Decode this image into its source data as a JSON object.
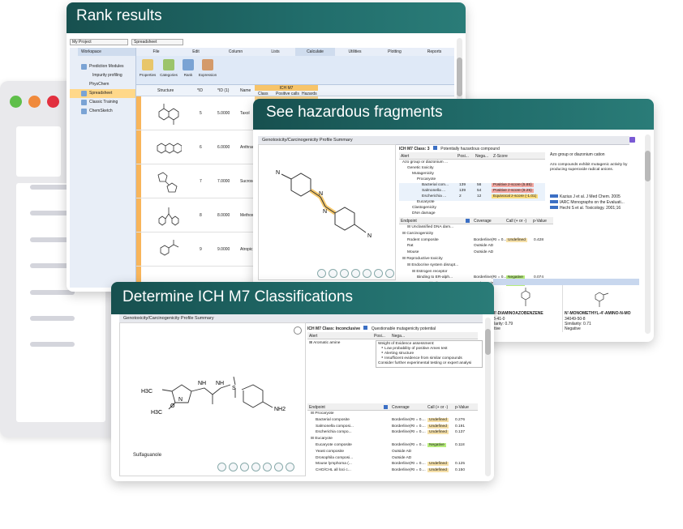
{
  "rank": {
    "title": "Rank results",
    "project": "My Project",
    "view": "Spreadsheet",
    "menu": [
      "File",
      "Edit",
      "Column",
      "Lists",
      "Calculate",
      "Utilities",
      "Plotting",
      "Reports"
    ],
    "ribbon": [
      "Properties",
      "Categories",
      "Rank",
      "Expression"
    ],
    "nav": {
      "workspace": "Workspace",
      "side_label": "Uses sources",
      "items": [
        "Prediction Modules",
        "Impurity profiling",
        "PhysChem",
        "Spreadsheet",
        "Classic Training",
        "ChemSketch"
      ]
    },
    "columns": {
      "structure": "Structure",
      "id": "*ID",
      "id1": "*ID (1)",
      "name": "Name",
      "group": "ICH M7",
      "class": "Class",
      "positive": "Positive calls",
      "hazards": "Hazards"
    },
    "rows": [
      {
        "id": "5",
        "id1": "5.0000",
        "name": "Taxol"
      },
      {
        "id": "6",
        "id1": "6.0000",
        "name": "Anthracen"
      },
      {
        "id": "7",
        "id1": "7.0000",
        "name": "Sucrose"
      },
      {
        "id": "8",
        "id1": "8.0000",
        "name": "Methoxycl"
      },
      {
        "id": "9",
        "id1": "9.0000",
        "name": "Atropic ac"
      }
    ]
  },
  "haz": {
    "title": "See hazardous fragments",
    "panel_title": "Genotoxicity/Carcinogenicity Profile Summary",
    "ich_class_label": "ICH M7 Class:",
    "ich_class_value": "3",
    "ich_class_desc": "Potentially hazardous compound",
    "alert_headers": [
      "Alert",
      "Posi...",
      "Nega...",
      "Z-Score"
    ],
    "alerts": [
      {
        "label": "Azo group or diazonium ...",
        "indent": 0
      },
      {
        "label": "Genetic toxicity",
        "indent": 1
      },
      {
        "label": "Mutagenicity",
        "indent": 2
      },
      {
        "label": "Procaryote",
        "indent": 3
      },
      {
        "label": "Bacterial com...",
        "indent": 4,
        "pos": "139",
        "neg": "56",
        "z": "Positive z-score (5.85)"
      },
      {
        "label": "Salmonella ...",
        "indent": 4,
        "pos": "139",
        "neg": "54",
        "z": "Positive z-score (6.25)"
      },
      {
        "label": "Escherichia ...",
        "indent": 4,
        "pos": "2",
        "neg": "12",
        "z": "Equivocal z-score (-1.01)"
      },
      {
        "label": "Eucaryote",
        "indent": 3
      },
      {
        "label": "Clastogenicity",
        "indent": 2
      },
      {
        "label": "DNA damage",
        "indent": 2
      }
    ],
    "desc_title": "Azo group or diazonium cation",
    "desc_text": "Azo compounds exhibit mutagenic activity by producing superoxide radical anions.",
    "refs": [
      "Kazius J et al. J Med Chem. 2005",
      "IARC Monographs on the Evaluati...",
      "Hecht S et al. Toxicology. 2001;16"
    ],
    "end_headers": [
      "Endpoint",
      "Coverage",
      "Call (+ or -)",
      "p-Value"
    ],
    "endpoints": [
      {
        "name": "Unclassified DNA dam...",
        "indent": 1
      },
      {
        "name": "Carcinogenicity",
        "indent": 0
      },
      {
        "name": "Rodent composite",
        "indent": 1,
        "cov": "Borderline(RI = 0....",
        "call": "Undefined",
        "p": "0.428"
      },
      {
        "name": "Rat",
        "indent": 1,
        "cov": "Outside AD"
      },
      {
        "name": "Mouse",
        "indent": 1,
        "cov": "Outside AD"
      },
      {
        "name": "Reproductive toxicity",
        "indent": 0
      },
      {
        "name": "Endocrine system disrupt...",
        "indent": 1
      },
      {
        "name": "Estrogen receptor",
        "indent": 2
      },
      {
        "name": "Binding to ER-alph...",
        "indent": 3,
        "cov": "Borderline(RI = 0....",
        "call": "Negative",
        "p": "0.074"
      },
      {
        "name": "Strong binding to E...",
        "indent": 3,
        "cov": "Moderate(RI = 0.48)",
        "call": "Negative",
        "p": "0.009"
      }
    ],
    "similar": [
      {
        "name": "4'-DIAMINOAZOBENZENE",
        "cas": "8-41-0",
        "sim": "ilarity: 0.79",
        "call": "itive"
      },
      {
        "name": "N'-MONOMETHYL-4'-AMINO-N-MO",
        "cas": "34049-50-8",
        "sim": "Similarity: 0.71",
        "call": "Negative"
      }
    ]
  },
  "ich": {
    "title": "Determine  ICH M7 Classifications",
    "panel_title": "Genotoxicity/Carcinogenicity Profile Summary",
    "compound": "Sulfaguanole",
    "ich_class_label": "ICH M7 Class:",
    "ich_class_value": "Inconclusive",
    "ich_class_desc": "Questionable mutagenicity potential",
    "alert_headers": [
      "Alert",
      "Posi...",
      "Nega..."
    ],
    "alert": "Aromatic amine",
    "woe": [
      "Weight of Evidence assessment:",
      "Low probability of positive Ames test",
      "Alerting structure",
      "Insufficient evidence from similar compounds",
      "Consider further experimental testing or expert analysi"
    ],
    "end_headers": [
      "Endpoint",
      "Coverage",
      "Call (+ or -)",
      "p-Value"
    ],
    "endpoints": [
      {
        "name": "Procaryote",
        "indent": 0
      },
      {
        "name": "Bacterial composite",
        "indent": 1,
        "cov": "Borderline(RI = 0....",
        "call": "Undefined",
        "p": "0.276"
      },
      {
        "name": "Salmonella composi...",
        "indent": 1,
        "cov": "Borderline(RI = 0....",
        "call": "Undefined",
        "p": "0.191"
      },
      {
        "name": "Escherichia compo...",
        "indent": 1,
        "cov": "Borderline(RI = 0....",
        "call": "Undefined",
        "p": "0.137"
      },
      {
        "name": "Eucaryote",
        "indent": 0
      },
      {
        "name": "Eucaryote composite",
        "indent": 1,
        "cov": "Borderline(RI = 0....",
        "call": "Negative",
        "p": "0.118"
      },
      {
        "name": "Yeast composite",
        "indent": 1,
        "cov": "Outside AD"
      },
      {
        "name": "Drosophila composi...",
        "indent": 1,
        "cov": "Outside AD"
      },
      {
        "name": "Mouse lymphoma (...",
        "indent": 1,
        "cov": "Borderline(RI = 0....",
        "call": "Undefined",
        "p": "0.125"
      },
      {
        "name": "CHO/CHL all loci c...",
        "indent": 1,
        "cov": "Borderline(RI = 0....",
        "call": "Undefined",
        "p": "0.150"
      }
    ],
    "mol_labels": [
      "H3C",
      "H3C",
      "NH",
      "NH",
      "NH2",
      "N",
      "O",
      "S"
    ]
  },
  "colors": {
    "header_teal": "#1f6867",
    "positive": "#f4a9a3",
    "equivocal": "#fbdc7a",
    "negative": "#b6ec7a",
    "undefined": "#f6e0a8",
    "highlight_orange": "#f8b55a"
  }
}
